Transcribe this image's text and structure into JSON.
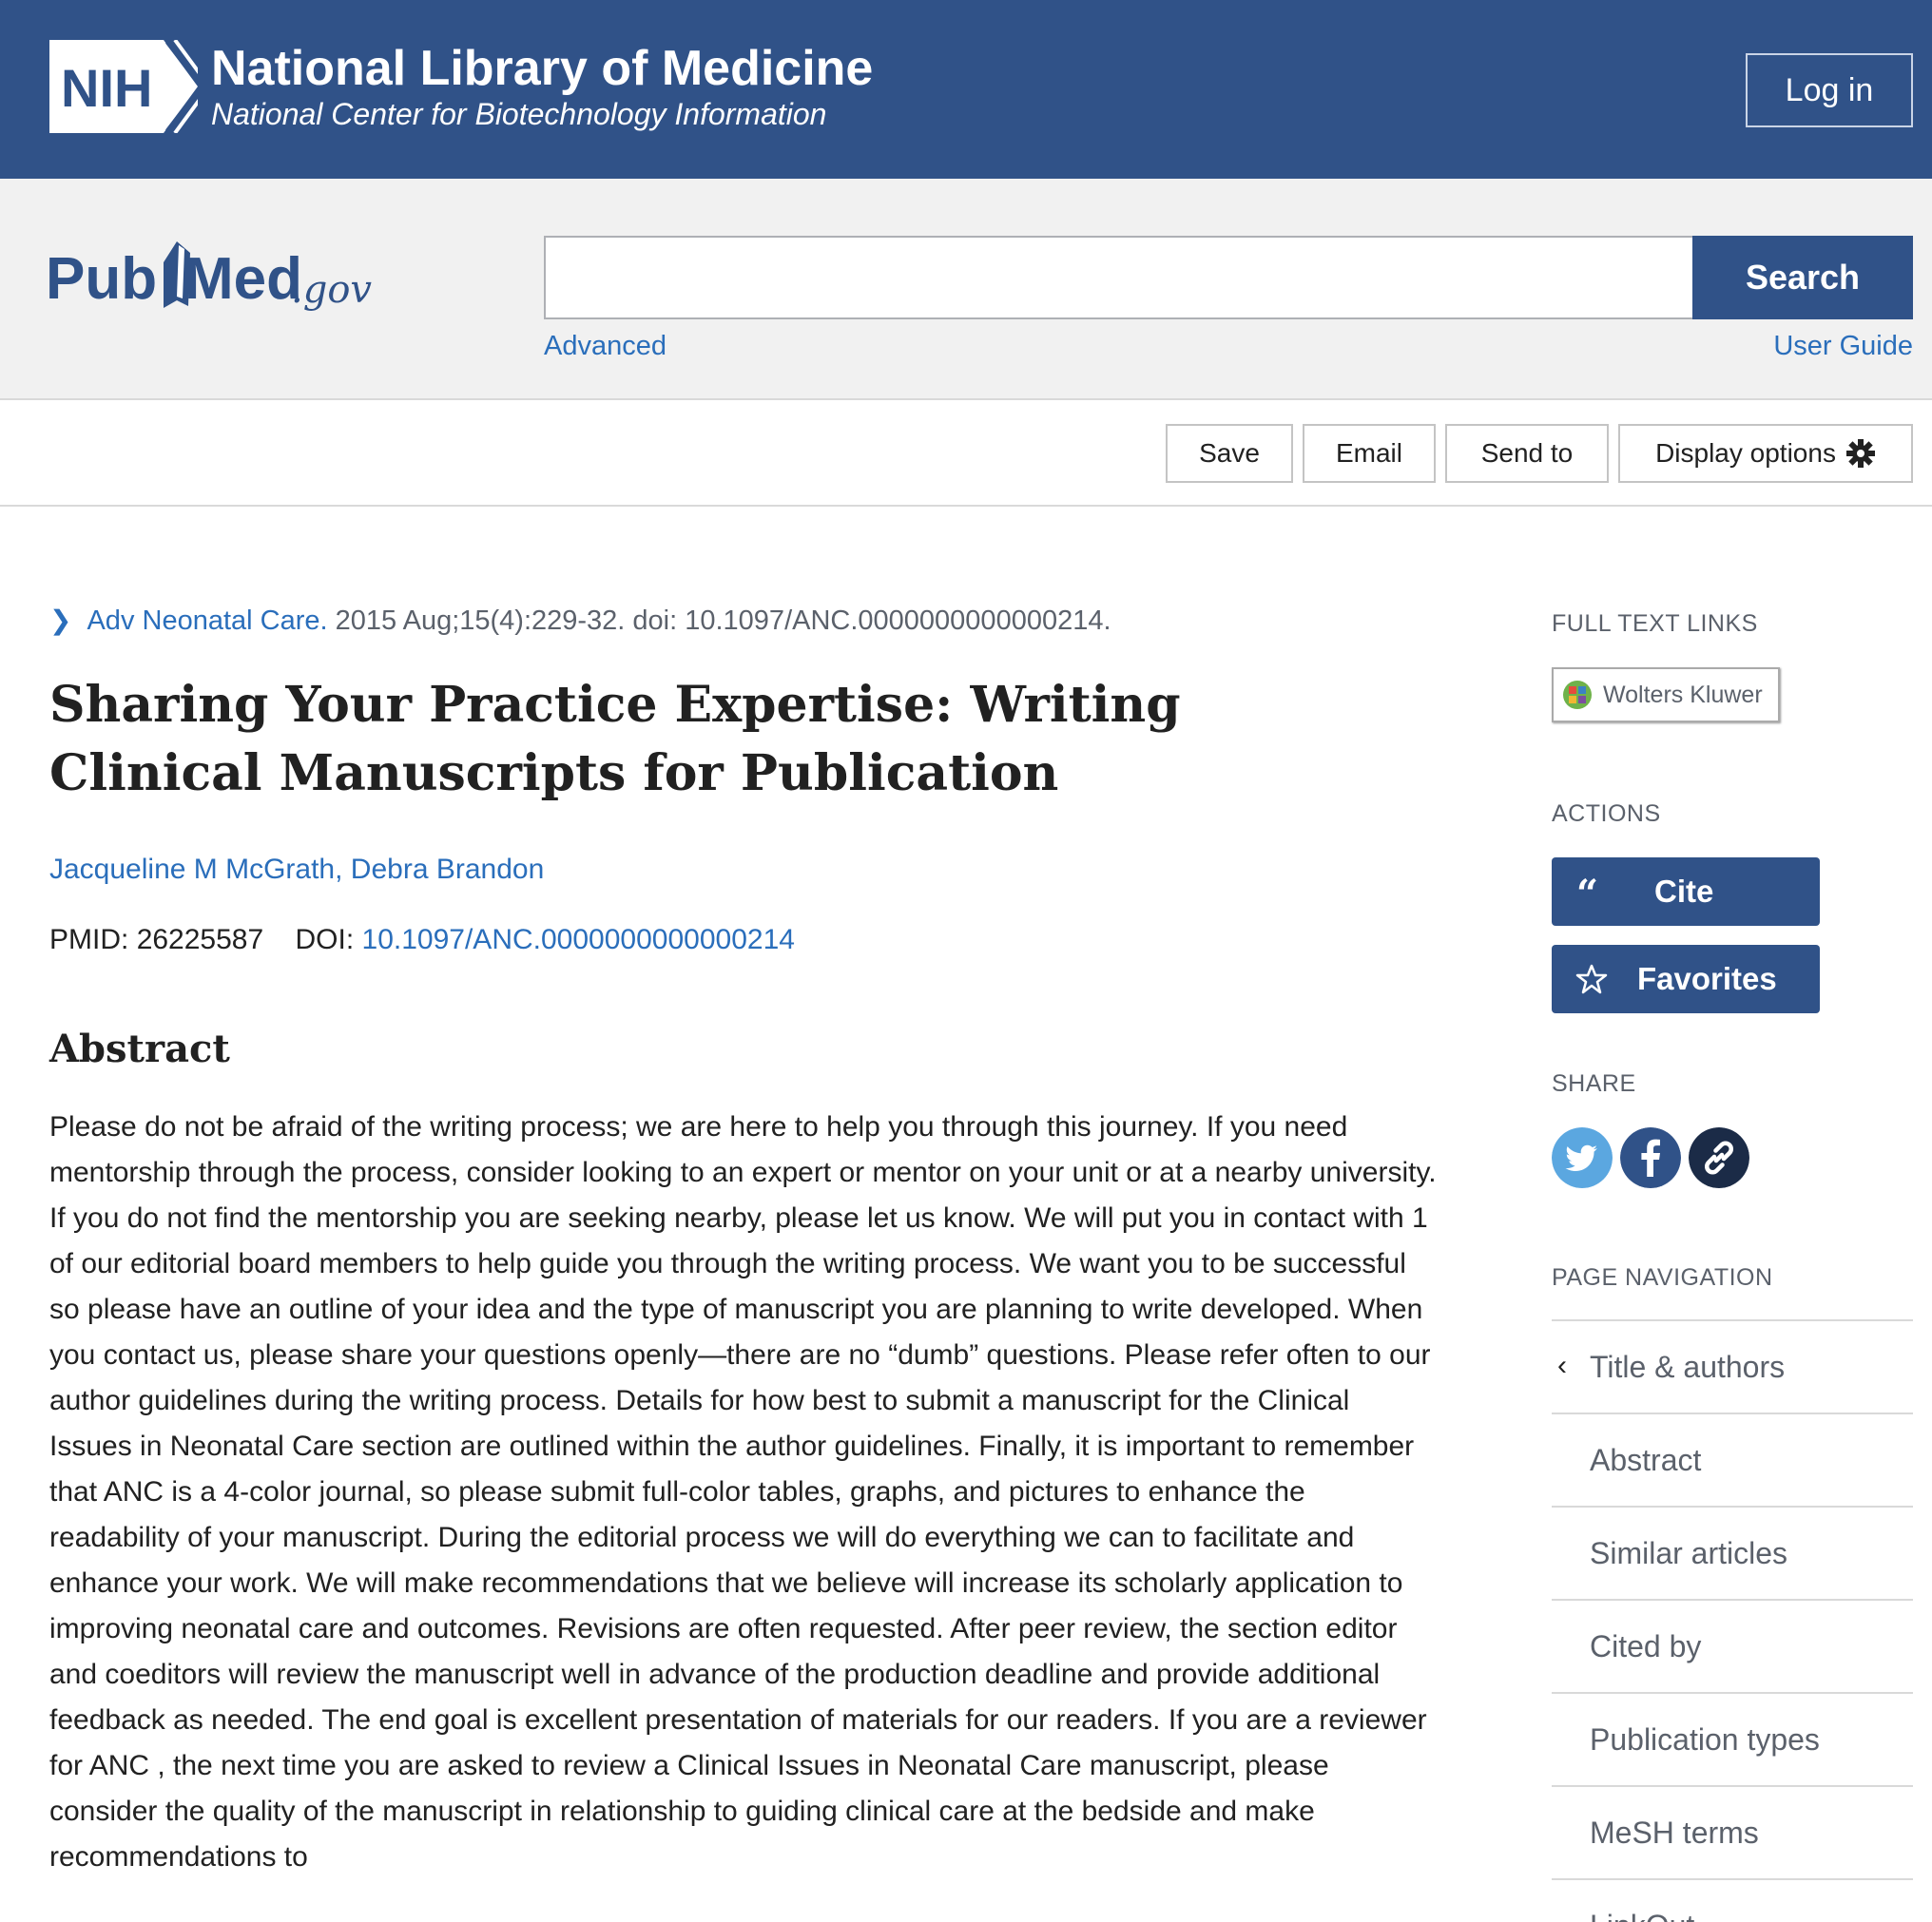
{
  "nih": {
    "logo_text": "NIH",
    "title": "National Library of Medicine",
    "subtitle": "National Center for Biotechnology Information",
    "login": "Log in"
  },
  "pubmed": {
    "logo_text": "PubMed.gov",
    "search_value": "",
    "search_button": "Search",
    "advanced": "Advanced",
    "user_guide": "User Guide"
  },
  "toolbar": {
    "save": "Save",
    "email": "Email",
    "send_to": "Send to",
    "display_options": "Display options"
  },
  "article": {
    "journal": "Adv Neonatal Care.",
    "citation_rest": "2015 Aug;15(4):229-32. doi: 10.1097/ANC.0000000000000214.",
    "title": "Sharing Your Practice Expertise: Writing Clinical Manuscripts for Publication",
    "authors": [
      "Jacqueline M McGrath",
      "Debra Brandon"
    ],
    "pmid_label": "PMID:",
    "pmid": "26225587",
    "doi_label": "DOI:",
    "doi": "10.1097/ANC.0000000000000214",
    "abstract_heading": "Abstract",
    "abstract": "Please do not be afraid of the writing process; we are here to help you through this journey. If you need mentorship through the process, consider looking to an expert or mentor on your unit or at a nearby university. If you do not find the mentorship you are seeking nearby, please let us know. We will put you in contact with 1 of our editorial board members to help guide you through the writing process. We want you to be successful so please have an outline of your idea and the type of manuscript you are planning to write developed. When you contact us, please share your questions openly—there are no “dumb” questions. Please refer often to our author guidelines during the writing process. Details for how best to submit a manuscript for the Clinical Issues in Neonatal Care section are outlined within the author guidelines. Finally, it is important to remember that ANC is a 4-color journal, so please submit full-color tables, graphs, and pictures to enhance the readability of your manuscript. During the editorial process we will do everything we can to facilitate and enhance your work. We will make recommendations that we believe will increase its scholarly application to improving neonatal care and outcomes. Revisions are often requested. After peer review, the section editor and coeditors will review the manuscript well in advance of the production deadline and provide additional feedback as needed. The end goal is excellent presentation of materials for our readers. If you are a reviewer for ANC , the next time you are asked to review a Clinical Issues in Neonatal Care manuscript, please consider the quality of the manuscript in relationship to guiding clinical care at the bedside and make recommendations to"
  },
  "sidebar": {
    "full_text_label": "FULL TEXT LINKS",
    "full_text_provider": "Wolters Kluwer",
    "actions_label": "ACTIONS",
    "cite": "Cite",
    "favorites": "Favorites",
    "share_label": "SHARE",
    "share_icons": [
      "twitter-icon",
      "facebook-icon",
      "link-icon"
    ],
    "page_nav_label": "PAGE NAVIGATION",
    "nav_items": [
      {
        "label": "Title & authors"
      },
      {
        "label": "Abstract"
      },
      {
        "label": "Similar articles"
      },
      {
        "label": "Cited by"
      },
      {
        "label": "Publication types"
      },
      {
        "label": "MeSH terms"
      },
      {
        "label": "LinkOut"
      }
    ]
  },
  "colors": {
    "nih_blue": "#305288",
    "link_blue": "#2a6ebb",
    "band_gray": "#f1f1f1",
    "twitter": "#5ba7e0",
    "facebook": "#305288",
    "link_dark": "#1b2b47"
  }
}
